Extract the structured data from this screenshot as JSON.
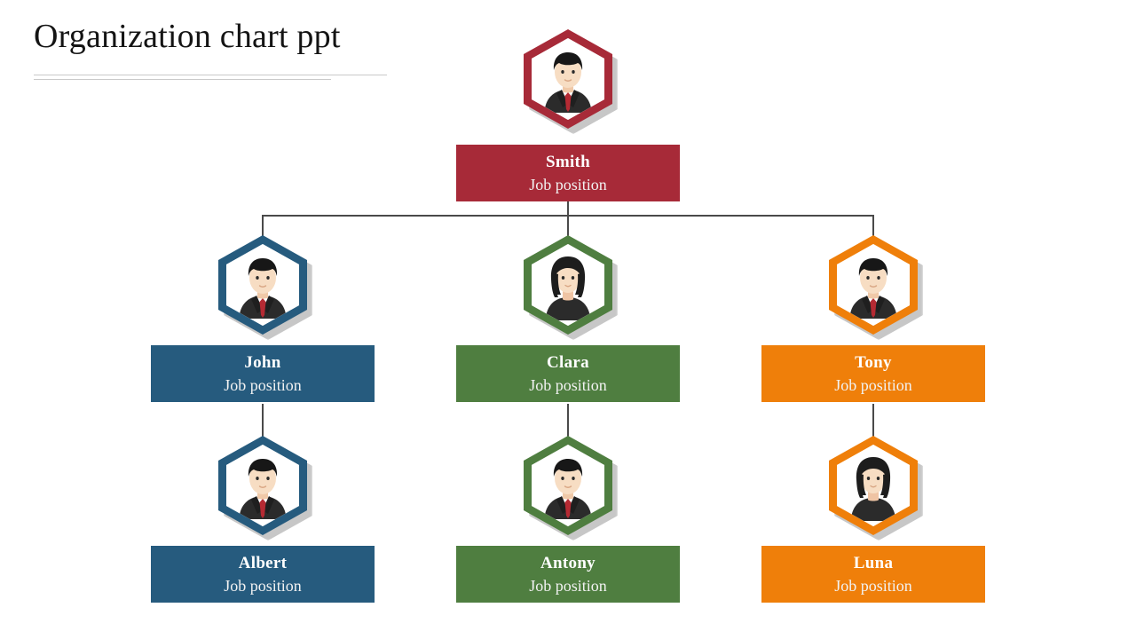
{
  "slide": {
    "title": "Organization chart ppt",
    "background": "#ffffff"
  },
  "palette": {
    "red": "#a72a38",
    "blue": "#265b7e",
    "green": "#4f7e40",
    "orange": "#ef7f0a",
    "connector": "#4a4a4a",
    "rule": "#c9c9c9",
    "hex_inner": "#ffffff",
    "text_on_bar": "#ffffff"
  },
  "chart_data": {
    "type": "diagram",
    "diagram_type": "organization-chart",
    "title": "Organization chart ppt",
    "levels": 3,
    "nodes": [
      {
        "id": "smith",
        "name": "Smith",
        "role": "Job position",
        "color": "#a72a38",
        "avatar": "male",
        "level": 1,
        "parent": null
      },
      {
        "id": "john",
        "name": "John",
        "role": "Job position",
        "color": "#265b7e",
        "avatar": "male",
        "level": 2,
        "parent": "smith"
      },
      {
        "id": "clara",
        "name": "Clara",
        "role": "Job position",
        "color": "#4f7e40",
        "avatar": "female",
        "level": 2,
        "parent": "smith"
      },
      {
        "id": "tony",
        "name": "Tony",
        "role": "Job position",
        "color": "#ef7f0a",
        "avatar": "male",
        "level": 2,
        "parent": "smith"
      },
      {
        "id": "albert",
        "name": "Albert",
        "role": "Job position",
        "color": "#265b7e",
        "avatar": "male",
        "level": 3,
        "parent": "john"
      },
      {
        "id": "antony",
        "name": "Antony",
        "role": "Job position",
        "color": "#4f7e40",
        "avatar": "male",
        "level": 3,
        "parent": "clara"
      },
      {
        "id": "luna",
        "name": "Luna",
        "role": "Job position",
        "color": "#ef7f0a",
        "avatar": "female",
        "level": 3,
        "parent": "tony"
      }
    ],
    "edges": [
      {
        "from": "smith",
        "to": "john"
      },
      {
        "from": "smith",
        "to": "clara"
      },
      {
        "from": "smith",
        "to": "tony"
      },
      {
        "from": "john",
        "to": "albert"
      },
      {
        "from": "clara",
        "to": "antony"
      },
      {
        "from": "tony",
        "to": "luna"
      }
    ]
  }
}
